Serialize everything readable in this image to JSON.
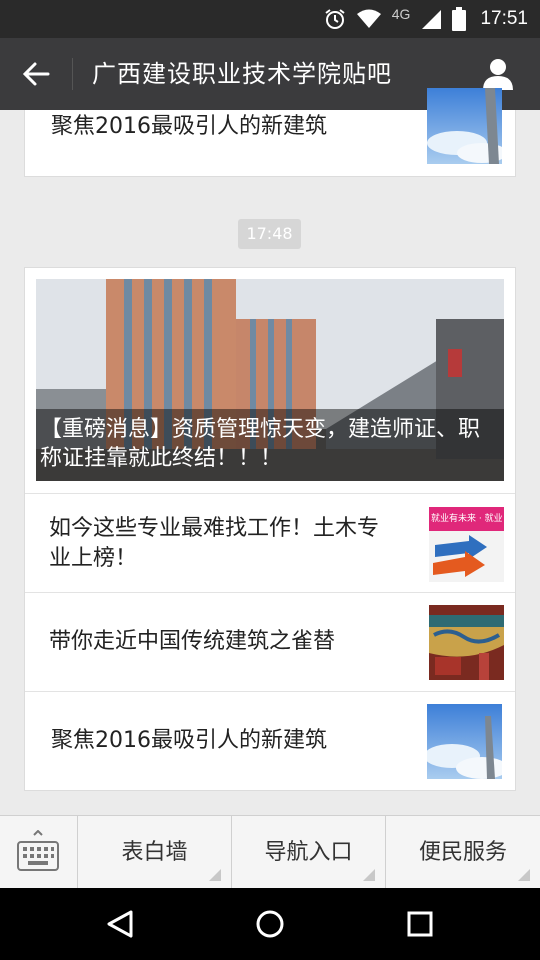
{
  "status_bar": {
    "network": "4G",
    "time": "17:51"
  },
  "title_bar": {
    "title": "广西建设职业技术学院贴吧"
  },
  "top_card": {
    "title": "聚焦2016最吸引人的新建筑"
  },
  "time_badge": "17:48",
  "news_card": {
    "headline": "【重磅消息】资质管理惊天变，建造师证、职称证挂靠就此终结！！！",
    "items": [
      {
        "title": "如今这些专业最难找工作！土木专业上榜！",
        "thumb_text": "就业有未来 · 就业"
      },
      {
        "title": "带你走近中国传统建筑之雀替",
        "thumb_text": ""
      },
      {
        "title": "聚焦2016最吸引人的新建筑",
        "thumb_text": ""
      }
    ]
  },
  "menu": {
    "items": [
      "表白墙",
      "导航入口",
      "便民服务"
    ]
  }
}
